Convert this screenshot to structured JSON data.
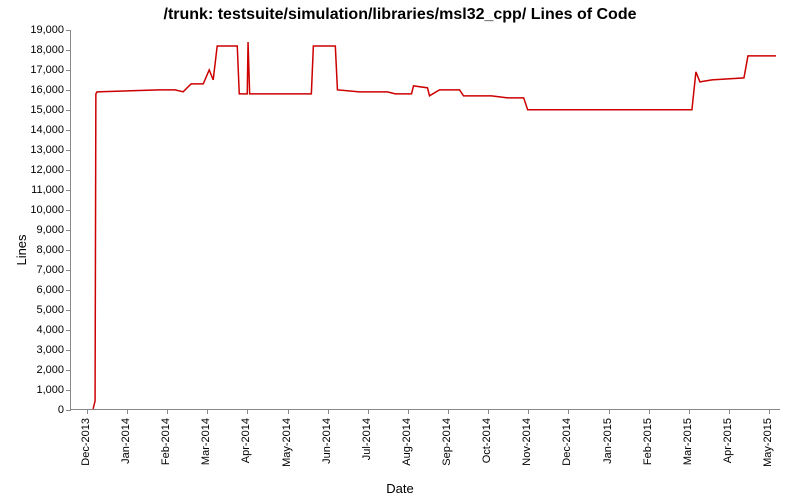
{
  "chart_data": {
    "type": "line",
    "title": "/trunk: testsuite/simulation/libraries/msl32_cpp/ Lines of Code",
    "xlabel": "Date",
    "ylabel": "Lines",
    "ylim": [
      0,
      19000
    ],
    "y_ticks": [
      0,
      1000,
      2000,
      3000,
      4000,
      5000,
      6000,
      7000,
      8000,
      9000,
      10000,
      11000,
      12000,
      13000,
      14000,
      15000,
      16000,
      17000,
      18000,
      19000
    ],
    "y_tick_labels": [
      "0",
      "1,000",
      "2,000",
      "3,000",
      "4,000",
      "5,000",
      "6,000",
      "7,000",
      "8,000",
      "9,000",
      "10,000",
      "11,000",
      "12,000",
      "13,000",
      "14,000",
      "15,000",
      "16,000",
      "17,000",
      "18,000",
      "19,000"
    ],
    "x_tick_labels": [
      "Dec-2013",
      "Jan-2014",
      "Feb-2014",
      "Mar-2014",
      "Apr-2014",
      "May-2014",
      "Jun-2014",
      "Jul-2014",
      "Aug-2014",
      "Sep-2014",
      "Oct-2014",
      "Nov-2014",
      "Dec-2014",
      "Jan-2015",
      "Feb-2015",
      "Mar-2015",
      "Apr-2015",
      "May-2015"
    ],
    "x_range_months": 18,
    "series": [
      {
        "name": "lines",
        "color": "#cc0000",
        "points": [
          {
            "x": 0.15,
            "y": 0
          },
          {
            "x": 0.2,
            "y": 400
          },
          {
            "x": 0.22,
            "y": 15800
          },
          {
            "x": 0.25,
            "y": 15900
          },
          {
            "x": 1.8,
            "y": 16000
          },
          {
            "x": 2.2,
            "y": 16000
          },
          {
            "x": 2.4,
            "y": 15900
          },
          {
            "x": 2.6,
            "y": 16300
          },
          {
            "x": 2.9,
            "y": 16300
          },
          {
            "x": 3.05,
            "y": 17000
          },
          {
            "x": 3.15,
            "y": 16500
          },
          {
            "x": 3.25,
            "y": 18200
          },
          {
            "x": 3.75,
            "y": 18200
          },
          {
            "x": 3.8,
            "y": 15800
          },
          {
            "x": 4.0,
            "y": 15800
          },
          {
            "x": 4.02,
            "y": 18400
          },
          {
            "x": 4.06,
            "y": 15800
          },
          {
            "x": 5.6,
            "y": 15800
          },
          {
            "x": 5.65,
            "y": 18200
          },
          {
            "x": 6.2,
            "y": 18200
          },
          {
            "x": 6.25,
            "y": 16000
          },
          {
            "x": 6.8,
            "y": 15900
          },
          {
            "x": 7.5,
            "y": 15900
          },
          {
            "x": 7.7,
            "y": 15800
          },
          {
            "x": 8.1,
            "y": 15800
          },
          {
            "x": 8.15,
            "y": 16200
          },
          {
            "x": 8.5,
            "y": 16100
          },
          {
            "x": 8.55,
            "y": 15700
          },
          {
            "x": 8.8,
            "y": 16000
          },
          {
            "x": 9.3,
            "y": 16000
          },
          {
            "x": 9.4,
            "y": 15700
          },
          {
            "x": 10.1,
            "y": 15700
          },
          {
            "x": 10.5,
            "y": 15600
          },
          {
            "x": 10.9,
            "y": 15600
          },
          {
            "x": 11.0,
            "y": 15000
          },
          {
            "x": 15.1,
            "y": 15000
          },
          {
            "x": 15.2,
            "y": 16900
          },
          {
            "x": 15.3,
            "y": 16400
          },
          {
            "x": 15.6,
            "y": 16500
          },
          {
            "x": 16.4,
            "y": 16600
          },
          {
            "x": 16.5,
            "y": 17700
          },
          {
            "x": 17.2,
            "y": 17700
          }
        ]
      }
    ]
  }
}
